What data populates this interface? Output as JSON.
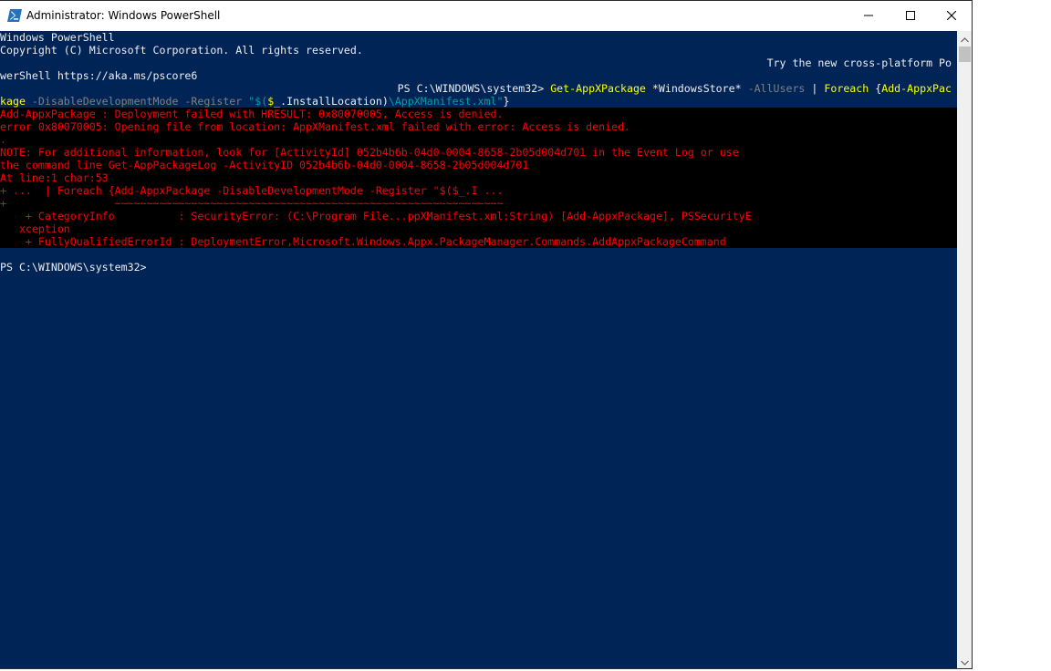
{
  "window": {
    "title": "Administrator: Windows PowerShell",
    "icon": "powershell-icon",
    "controls": {
      "minimize": "minimize-icon",
      "maximize": "maximize-icon",
      "close": "close-icon"
    }
  },
  "console": {
    "header_line1": "Windows PowerShell",
    "header_line2": "Copyright (C) Microsoft Corporation. All rights reserved.",
    "notice_line1": "Try the new cross-platform Po",
    "notice_line2": "werShell https://aka.ms/pscore6",
    "command": {
      "prompt": "PS C:\\WINDOWS\\system32> ",
      "cmdlet": "Get-AppXPackage",
      "arg": " *WindowsStore* ",
      "param_allusers": "-AllUsers",
      "pipe": " | ",
      "foreach": "Foreach",
      "brace_open": " {",
      "cmdlet2_part1": "Add-AppxPac",
      "cmdlet2_part2": "kage",
      "param_devmode": " -DisableDevelopmentMode",
      "param_register": " -Register",
      "quote_open": " \"$(",
      "var": "$_",
      "prop": ".InstallLocation)",
      "manifest": "\\AppXManifest.xml\"",
      "brace_close": "}"
    },
    "errors": [
      "Add-AppxPackage : Deployment failed with HRESULT: 0x80070005, Access is denied.",
      "error 0x80070005: Opening file from location: AppXManifest.xml failed with error: Access is denied.",
      ".",
      "NOTE: For additional information, look for [ActivityId] 052b4b6b-04d0-0004-8658-2b05d004d701 in the Event Log or use",
      "the command line Get-AppPackageLog -ActivityID 052b4b6b-04d0-0004-8658-2b05d004d701",
      "At line:1 char:53",
      "+ ...  | Foreach {Add-AppxPackage -DisableDevelopmentMode -Register \"$($_.I ...",
      "+                 ~~~~~~~~~~~~~~~~~~~~~~~~~~~~~~~~~~~~~~~~~~~~~~~~~~~~~~~~~~~~~",
      "    + CategoryInfo          : SecurityError: (C:\\Program File...ppXManifest.xml:String) [Add-AppxPackage], PSSecurityE",
      "   xception",
      "    + FullyQualifiedErrorId : DeploymentError,Microsoft.Windows.Appx.PackageManager.Commands.AddAppxPackageCommand"
    ],
    "final_prompt": "PS C:\\WINDOWS\\system32>"
  },
  "colors": {
    "console_bg": "#012456",
    "error_bg": "#000000",
    "error_text": "#ff0000",
    "cmdlet": "#ffff00",
    "parameter": "#808080",
    "string": "#00a0a0",
    "text": "#eeedf0"
  }
}
